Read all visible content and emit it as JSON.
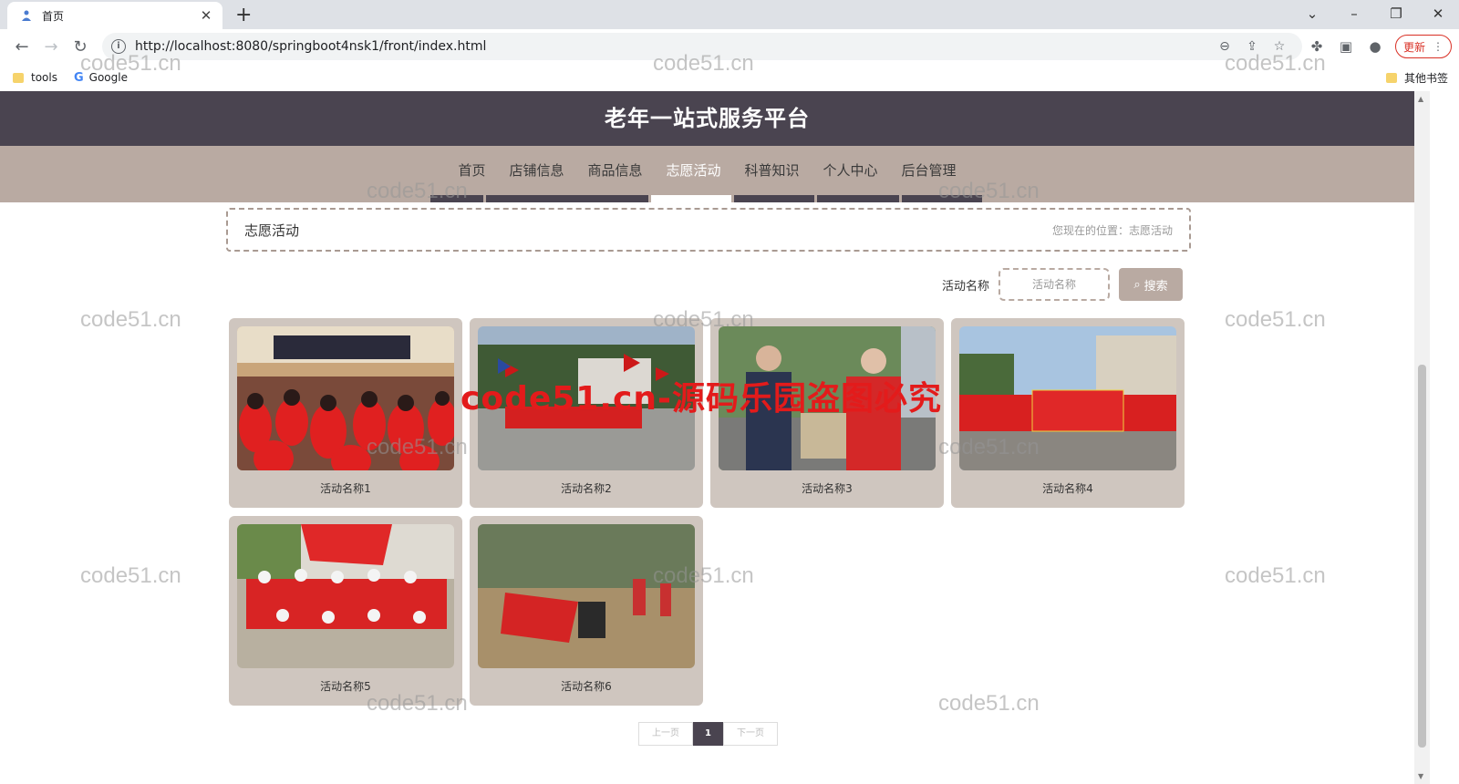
{
  "browser": {
    "tab_title": "首页",
    "url": "http://localhost:8080/springboot4nsk1/front/index.html",
    "update_label": "更新",
    "bookmarks": [
      "tools",
      "Google"
    ],
    "other_bookmarks": "其他书签"
  },
  "site": {
    "title": "老年一站式服务平台",
    "nav": [
      {
        "label": "首页"
      },
      {
        "label": "店铺信息"
      },
      {
        "label": "商品信息"
      },
      {
        "label": "志愿活动"
      },
      {
        "label": "科普知识"
      },
      {
        "label": "个人中心"
      },
      {
        "label": "后台管理"
      }
    ],
    "active_nav": "志愿活动"
  },
  "breadcrumb": {
    "title": "志愿活动",
    "location": "您现在的位置：志愿活动"
  },
  "search": {
    "label": "活动名称",
    "placeholder": "活动名称",
    "button": "搜索"
  },
  "activities": [
    {
      "name": "活动名称1"
    },
    {
      "name": "活动名称2"
    },
    {
      "name": "活动名称3"
    },
    {
      "name": "活动名称4"
    },
    {
      "name": "活动名称5"
    },
    {
      "name": "活动名称6"
    }
  ],
  "pagination": {
    "prev": "上一页",
    "current": "1",
    "next": "下一页"
  },
  "watermarks": {
    "site": "code51.cn",
    "warning": "code51.cn-源码乐园盗图必究"
  },
  "colors": {
    "header": "#4a4450",
    "nav": "#b9aaa2",
    "card": "#cfc6bf",
    "accent_red": "#e31b1b"
  }
}
